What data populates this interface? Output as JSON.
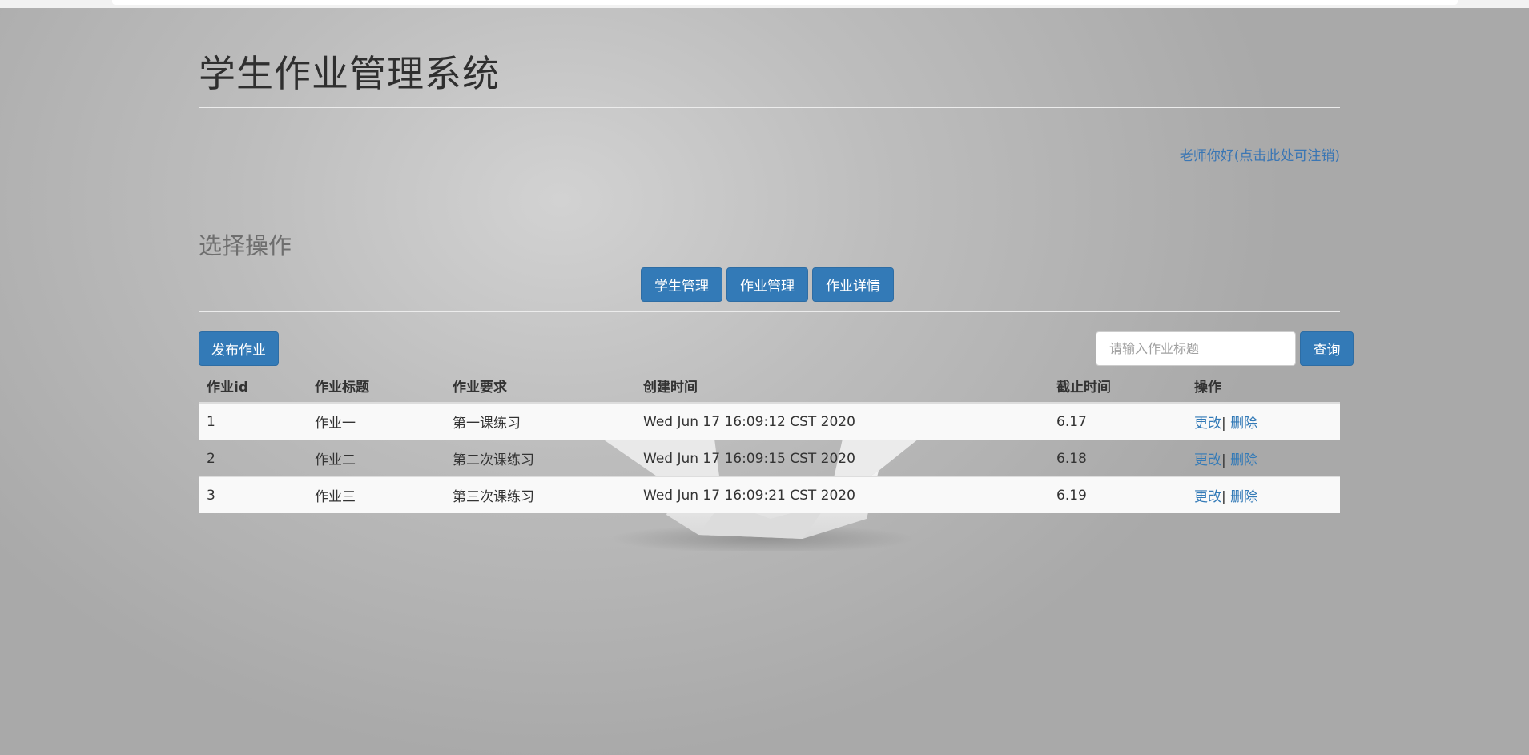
{
  "app": {
    "title": "学生作业管理系统",
    "greeting": "老师你好(点击此处可注销)"
  },
  "section": {
    "title": "选择操作"
  },
  "nav": {
    "buttons": [
      "学生管理",
      "作业管理",
      "作业详情"
    ]
  },
  "toolbar": {
    "publish_label": "发布作业",
    "search_placeholder": "请输入作业标题",
    "search_label": "查询"
  },
  "table": {
    "headers": [
      "作业id",
      "作业标题",
      "作业要求",
      "创建时间",
      "截止时间",
      "操作"
    ],
    "rows": [
      {
        "id": "1",
        "title": "作业一",
        "requirement": "第一课练习",
        "created": "Wed Jun 17 16:09:12 CST 2020",
        "deadline": "6.17",
        "edit": "更改",
        "separator": "|",
        "delete": "删除"
      },
      {
        "id": "2",
        "title": "作业二",
        "requirement": "第二次课练习",
        "created": "Wed Jun 17 16:09:15 CST 2020",
        "deadline": "6.18",
        "edit": "更改",
        "separator": "|",
        "delete": "删除"
      },
      {
        "id": "3",
        "title": "作业三",
        "requirement": "第三次课练习",
        "created": "Wed Jun 17 16:09:21 CST 2020",
        "deadline": "6.19",
        "edit": "更改",
        "separator": "|",
        "delete": "删除"
      }
    ]
  },
  "colors": {
    "primary": "#337ab7",
    "link": "#337ab7",
    "row_stripe": "#f9f9f9"
  }
}
